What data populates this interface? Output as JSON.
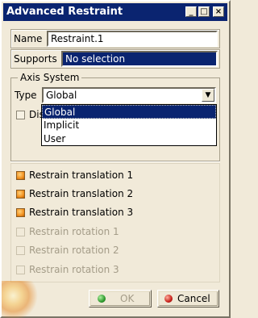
{
  "window": {
    "title": "Advanced Restraint",
    "minimize_glyph": "_",
    "maximize_glyph": "□",
    "close_glyph": "×"
  },
  "name": {
    "label": "Name",
    "value": "Restraint.1"
  },
  "supports": {
    "label": "Supports",
    "value": "No selection"
  },
  "axis_system": {
    "legend": "Axis System",
    "type_label": "Type",
    "type_value": "Global",
    "dropdown_options": [
      "Global",
      "Implicit",
      "User"
    ],
    "display_label_partial": "Dis"
  },
  "restraints": [
    {
      "label": "Restrain translation 1",
      "checked": true,
      "enabled": true
    },
    {
      "label": "Restrain translation 2",
      "checked": true,
      "enabled": true
    },
    {
      "label": "Restrain translation 3",
      "checked": true,
      "enabled": true
    },
    {
      "label": "Restrain rotation 1",
      "checked": false,
      "enabled": false
    },
    {
      "label": "Restrain rotation 2",
      "checked": false,
      "enabled": false
    },
    {
      "label": "Restrain rotation 3",
      "checked": false,
      "enabled": false
    }
  ],
  "buttons": {
    "ok": "OK",
    "cancel": "Cancel"
  },
  "colors": {
    "titlebar": "#0a2470",
    "selection": "#0a2470",
    "ok_dot": "#2e9a2e",
    "cancel_dot": "#c8201a",
    "checkbox_on": "#f29221"
  }
}
